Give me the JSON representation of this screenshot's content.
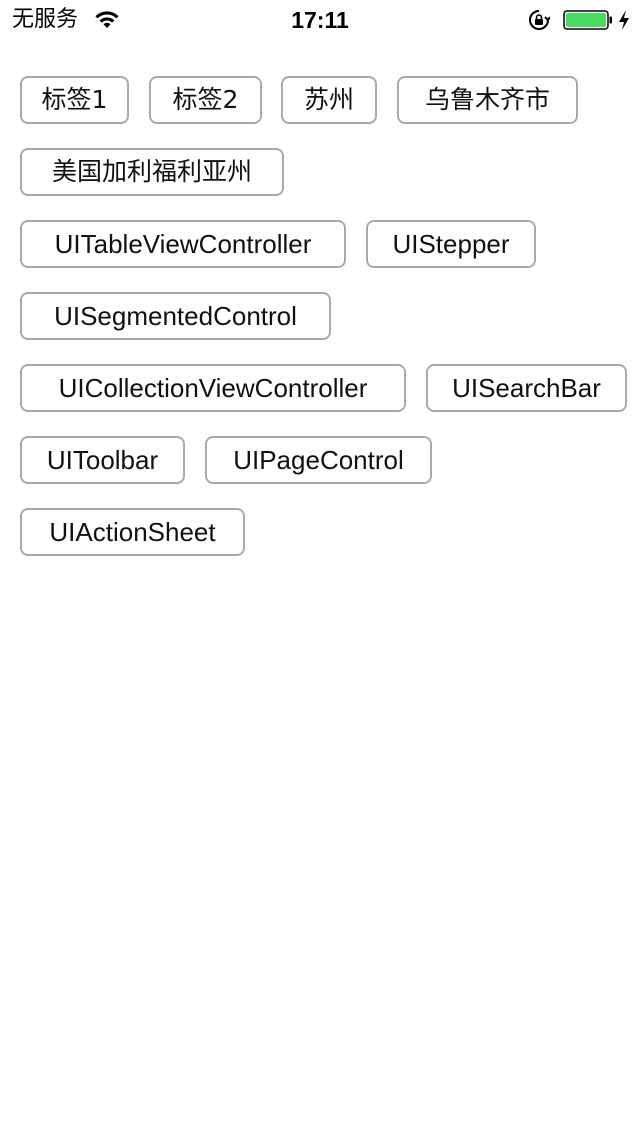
{
  "status_bar": {
    "carrier": "无服务",
    "time": "17:11",
    "battery_color": "#4cd964"
  },
  "tags": [
    {
      "label": "标签1"
    },
    {
      "label": "标签2"
    },
    {
      "label": "苏州"
    },
    {
      "label": "乌鲁木齐市"
    },
    {
      "label": "美国加利福利亚州"
    },
    {
      "label": "UITableViewController"
    },
    {
      "label": "UIStepper"
    },
    {
      "label": "UISegmentedControl"
    },
    {
      "label": "UICollectionViewController"
    },
    {
      "label": "UISearchBar"
    },
    {
      "label": "UIToolbar"
    },
    {
      "label": "UIPageControl"
    },
    {
      "label": "UIActionSheet"
    }
  ]
}
